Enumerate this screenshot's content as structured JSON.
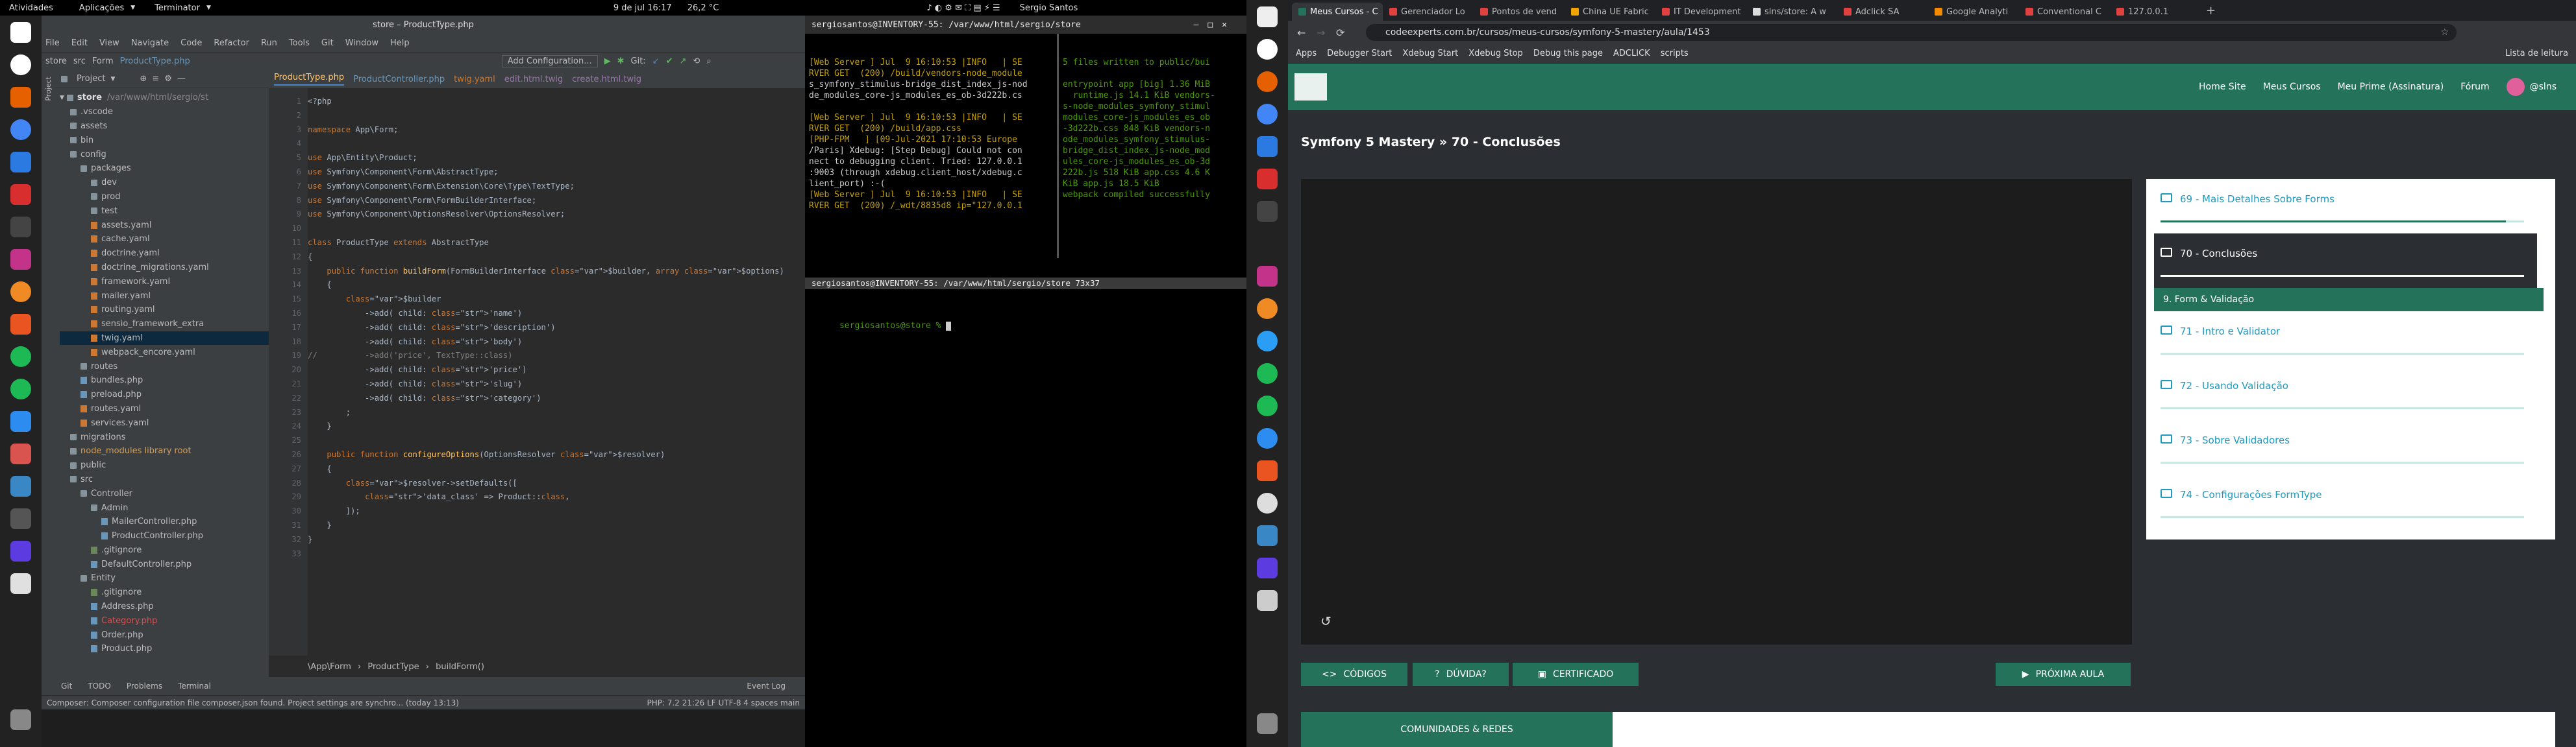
{
  "desktop": {
    "activities": "Atividades",
    "apps_menu": "Aplicações",
    "terminal_menu": "Terminator",
    "clock": "9 de jul  16:17",
    "weather": "26,2 °C",
    "user": "Sergio Santos"
  },
  "ide": {
    "title": "store – ProductType.php",
    "menu": [
      "File",
      "Edit",
      "View",
      "Navigate",
      "Code",
      "Refactor",
      "Run",
      "Tools",
      "Git",
      "Window",
      "Help"
    ],
    "nav_breadcrumb": [
      "store",
      "src",
      "Form",
      "ProductType.php"
    ],
    "add_configuration": "Add Configuration...",
    "git_label": "Git:",
    "project_label": "Project",
    "tabs": [
      "ProductType.php",
      "ProductController.php",
      "twig.yaml",
      "edit.html.twig",
      "create.html.twig"
    ],
    "tree_root": "store",
    "tree_root_path": "/var/www/html/sergio/st",
    "tree": [
      {
        "name": ".vscode",
        "kind": "folder"
      },
      {
        "name": "assets",
        "kind": "folder"
      },
      {
        "name": "bin",
        "kind": "folder"
      },
      {
        "name": "config",
        "kind": "folder"
      },
      {
        "name": "packages",
        "kind": "folder"
      },
      {
        "name": "dev",
        "kind": "folder"
      },
      {
        "name": "prod",
        "kind": "folder"
      },
      {
        "name": "test",
        "kind": "folder"
      },
      {
        "name": "assets.yaml",
        "kind": "yml"
      },
      {
        "name": "cache.yaml",
        "kind": "yml"
      },
      {
        "name": "doctrine.yaml",
        "kind": "yml"
      },
      {
        "name": "doctrine_migrations.yaml",
        "kind": "yml"
      },
      {
        "name": "framework.yaml",
        "kind": "yml"
      },
      {
        "name": "mailer.yaml",
        "kind": "yml"
      },
      {
        "name": "routing.yaml",
        "kind": "yml"
      },
      {
        "name": "sensio_framework_extra",
        "kind": "yml"
      },
      {
        "name": "twig.yaml",
        "kind": "yml"
      },
      {
        "name": "webpack_encore.yaml",
        "kind": "yml"
      },
      {
        "name": "routes",
        "kind": "folder"
      },
      {
        "name": "bundles.php",
        "kind": "php"
      },
      {
        "name": "preload.php",
        "kind": "php"
      },
      {
        "name": "routes.yaml",
        "kind": "yml"
      },
      {
        "name": "services.yaml",
        "kind": "yml"
      },
      {
        "name": "migrations",
        "kind": "folder"
      },
      {
        "name": "node_modules  library root",
        "kind": "folder"
      },
      {
        "name": "public",
        "kind": "folder"
      },
      {
        "name": "src",
        "kind": "folder"
      },
      {
        "name": "Controller",
        "kind": "folder"
      },
      {
        "name": "Admin",
        "kind": "folder"
      },
      {
        "name": "MailerController.php",
        "kind": "php"
      },
      {
        "name": "ProductController.php",
        "kind": "php"
      },
      {
        "name": ".gitignore",
        "kind": "file"
      },
      {
        "name": "DefaultController.php",
        "kind": "php"
      },
      {
        "name": "Entity",
        "kind": "folder"
      },
      {
        "name": ".gitignore",
        "kind": "file"
      },
      {
        "name": "Address.php",
        "kind": "php"
      },
      {
        "name": "Category.php",
        "kind": "php"
      },
      {
        "name": "Order.php",
        "kind": "php"
      },
      {
        "name": "Product.php",
        "kind": "php"
      }
    ],
    "breadcrumb_bottom": [
      "\\App\\Form",
      "ProductType",
      "buildForm()"
    ],
    "tool_tabs": [
      "Git",
      "TODO",
      "Problems",
      "Terminal",
      "Event Log"
    ],
    "status": "Composer: Composer configuration file composer.json found. Project settings are synchro... (today 13:13)",
    "status_right": "PHP: 7.2   21:26   LF   UTF-8   4 spaces   main"
  },
  "terminal": {
    "title": "sergiosantos@INVENTORY-55: /var/www/html/sergio/store",
    "pane_top_left": [
      "[Web Server ] Jul  9 16:10:53 |INFO   | SE",
      "RVER GET  (200) /build/vendors-node_module",
      "s_symfony_stimulus-bridge_dist_index_js-nod",
      "de_modules_core-js_modules_es_ob-3d222b.cs",
      "",
      "[Web Server ] Jul  9 16:10:53 |INFO   | SE",
      "RVER GET  (200) /build/app.css",
      "[PHP-FPM   ] [09-Jul-2021 17:10:53 Europe",
      "/Paris] Xdebug: [Step Debug] Could not con",
      "nect to debugging client. Tried: 127.0.0.1",
      ":9003 (through xdebug.client_host/xdebug.c",
      "lient_port) :-(",
      "[Web Server ] Jul  9 16:10:53 |INFO   | SE",
      "RVER GET  (200) /_wdt/8835d8 ip=\"127.0.0.1"
    ],
    "pane_top_right": [
      "5 files written to public/bui",
      "",
      "entrypoint app [big] 1.36 MiB",
      "  runtime.js 14.1 KiB vendors-",
      "s-node_modules_symfony_stimul",
      "modules_core-js_modules_es_ob",
      "-3d222b.css 848 KiB vendors-n",
      "ode_modules_symfony_stimulus-",
      "bridge_dist_index_js-node_mod",
      "ules_core-js_modules_es_ob-3d",
      "222b.js 518 KiB app.css 4.6 K",
      "KiB app.js 18.5 KiB",
      "webpack compiled successfully"
    ],
    "pane2_title": "sergiosantos@INVENTORY-55: /var/www/html/sergio/store 73x37",
    "prompt": "sergiosantos@store % "
  },
  "code_lines": [
    {
      "n": "1",
      "t": "<?php"
    },
    {
      "n": "2",
      "t": ""
    },
    {
      "n": "3",
      "t": "namespace App\\Form;"
    },
    {
      "n": "4",
      "t": ""
    },
    {
      "n": "5",
      "t": "use App\\Entity\\Product;"
    },
    {
      "n": "6",
      "t": "use Symfony\\Component\\Form\\AbstractType;"
    },
    {
      "n": "7",
      "t": "use Symfony\\Component\\Form\\Extension\\Core\\Type\\TextType;"
    },
    {
      "n": "8",
      "t": "use Symfony\\Component\\Form\\FormBuilderInterface;"
    },
    {
      "n": "9",
      "t": "use Symfony\\Component\\OptionsResolver\\OptionsResolver;"
    },
    {
      "n": "10",
      "t": ""
    },
    {
      "n": "11",
      "t": "class ProductType extends AbstractType"
    },
    {
      "n": "12",
      "t": "{"
    },
    {
      "n": "13",
      "t": "    public function buildForm(FormBuilderInterface $builder, array $options)"
    },
    {
      "n": "14",
      "t": "    {"
    },
    {
      "n": "15",
      "t": "        $builder"
    },
    {
      "n": "16",
      "t": "            ->add( child: 'name')"
    },
    {
      "n": "17",
      "t": "            ->add( child: 'description')"
    },
    {
      "n": "18",
      "t": "            ->add( child: 'body')"
    },
    {
      "n": "19",
      "t": "//          ->add('price', TextType::class)"
    },
    {
      "n": "20",
      "t": "            ->add( child: 'price')"
    },
    {
      "n": "21",
      "t": "            ->add( child: 'slug')"
    },
    {
      "n": "22",
      "t": "            ->add( child: 'category')"
    },
    {
      "n": "23",
      "t": "        ;"
    },
    {
      "n": "24",
      "t": "    }"
    },
    {
      "n": "25",
      "t": ""
    },
    {
      "n": "26",
      "t": "    public function configureOptions(OptionsResolver $resolver)"
    },
    {
      "n": "27",
      "t": "    {"
    },
    {
      "n": "28",
      "t": "        $resolver->setDefaults(["
    },
    {
      "n": "29",
      "t": "            'data_class' => Product::class,"
    },
    {
      "n": "30",
      "t": "        ]);"
    },
    {
      "n": "31",
      "t": "    }"
    },
    {
      "n": "32",
      "t": "}"
    },
    {
      "n": "33",
      "t": ""
    }
  ],
  "browser": {
    "tabs": [
      "Meus Cursos - C",
      "Gerenciador Lo",
      "Pontos de vend",
      "China UE Fabric",
      "IT Development",
      "slns/store: A w",
      "Adclick SA",
      "Google Analyti",
      "Conventional C",
      "127.0.0.1"
    ],
    "url": "codeexperts.com.br/cursos/meus-cursos/symfony-5-mastery/aula/1453",
    "bookmarks": [
      "Apps",
      "Debugger Start",
      "Xdebug Start",
      "Xdebug Stop",
      "Debug this page",
      "ADCLICK",
      "scripts"
    ],
    "reading_list": "Lista de leitura",
    "nav": [
      "Home Site",
      "Meus Cursos",
      "Meu Prime (Assinatura)",
      "Fórum"
    ],
    "user": "@slns",
    "page_title": "Symfony 5 Mastery » 70 - Conclusões",
    "playlist": [
      {
        "label": "69 - Mais Detalhes Sobre Forms",
        "progress": 0.95,
        "state": "normal"
      },
      {
        "label": "70 - Conclusões",
        "progress": 1.0,
        "state": "active"
      },
      {
        "label": "9. Form & Validação",
        "progress": 0,
        "state": "section"
      },
      {
        "label": "71 - Intro e Validator",
        "progress": 0,
        "state": "normal"
      },
      {
        "label": "72 - Usando Validação",
        "progress": 0,
        "state": "normal"
      },
      {
        "label": "73 - Sobre Validadores",
        "progress": 0,
        "state": "normal"
      },
      {
        "label": "74 - Configurações FormType",
        "progress": 0,
        "state": "normal"
      }
    ],
    "btn_codigos": "CÓDIGOS",
    "btn_duvida": "DÚVIDA?",
    "btn_certificado": "CERTIFICADO",
    "btn_proxima": "PRÓXIMA AULA",
    "community_tab": "COMUNIDADES & REDES"
  },
  "colors": {
    "accent": "#24725a",
    "link": "#1e9ac0",
    "ide_bg": "#2b2b2b",
    "terminal_green": "#4e9a06"
  }
}
